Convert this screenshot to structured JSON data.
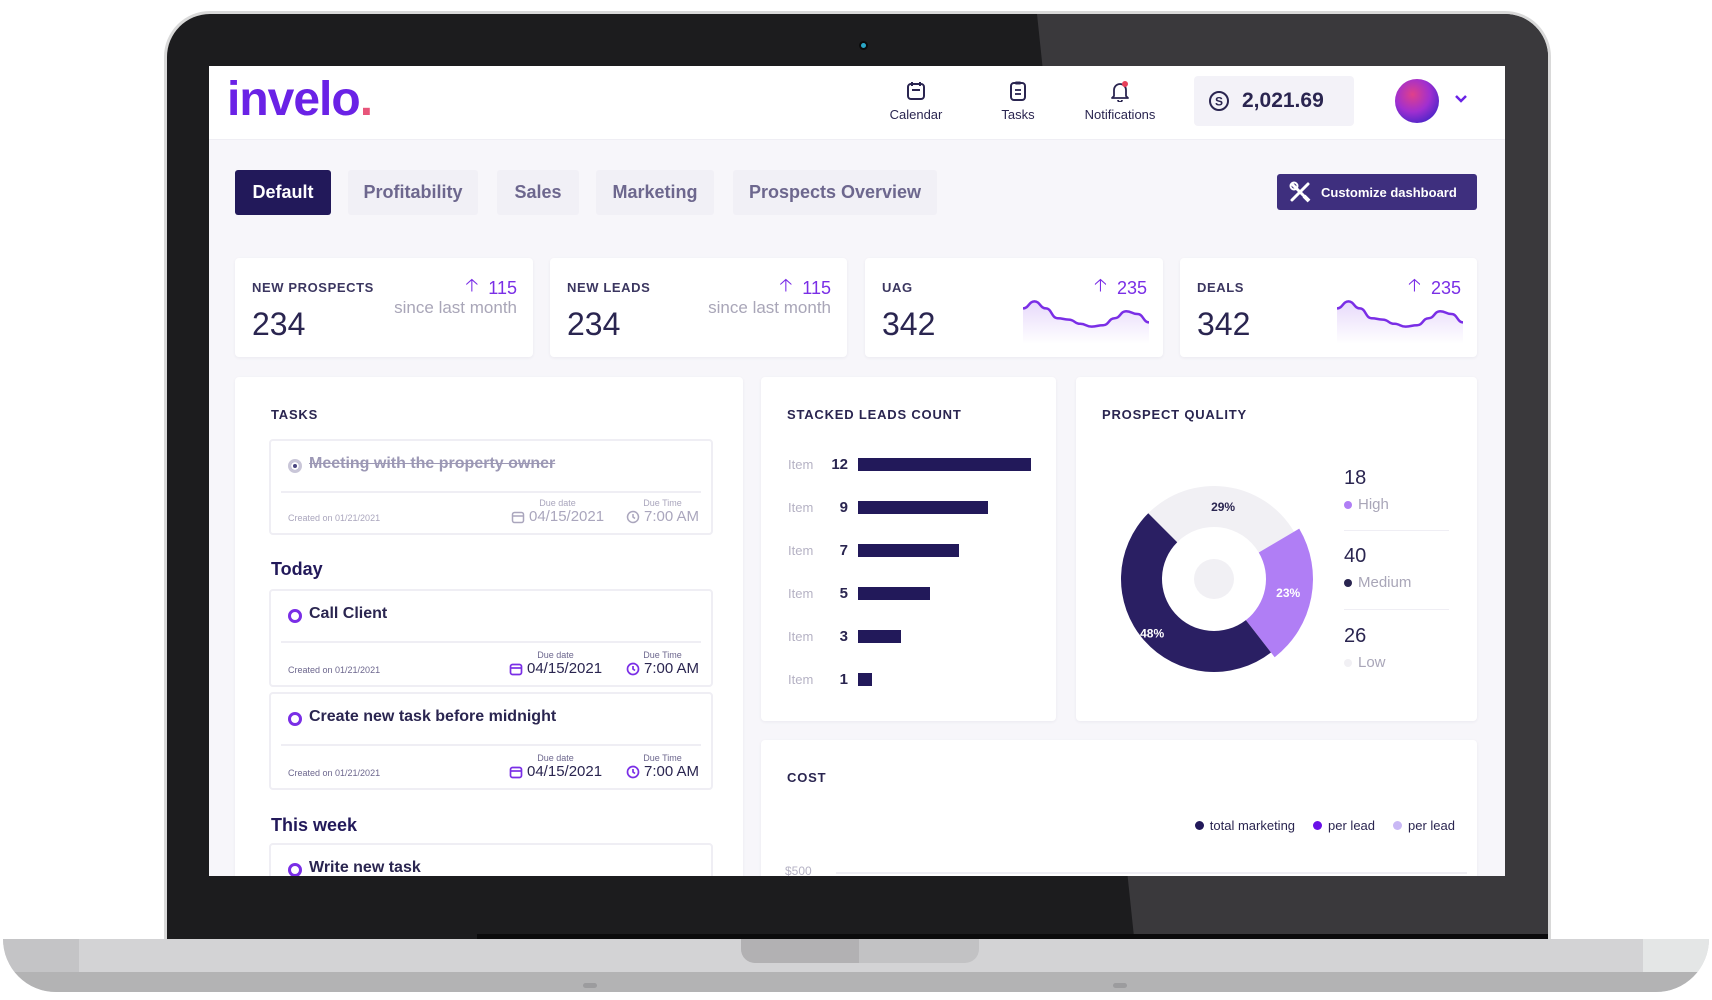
{
  "app": {
    "logo": "invelo",
    "logo_dot": ".",
    "accent_color": "#6a22e6",
    "dark_color": "#22195a"
  },
  "header": {
    "nav": [
      {
        "label": "Calendar",
        "icon": "calendar-icon"
      },
      {
        "label": "Tasks",
        "icon": "clipboard-icon"
      },
      {
        "label": "Notifications",
        "icon": "bell-icon"
      }
    ],
    "balance": "2,021.69",
    "balance_icon": "dollar-circle-icon"
  },
  "tabs": [
    {
      "label": "Default",
      "active": true
    },
    {
      "label": "Profitability",
      "active": false
    },
    {
      "label": "Sales",
      "active": false
    },
    {
      "label": "Marketing",
      "active": false
    },
    {
      "label": "Prospects Overview",
      "active": false
    }
  ],
  "customize_label": "Customize dashboard",
  "stats": [
    {
      "label": "NEW PROSPECTS",
      "value": "234",
      "delta": "115",
      "sub": "since last month"
    },
    {
      "label": "NEW LEADS",
      "value": "234",
      "delta": "115",
      "sub": "since last month"
    },
    {
      "label": "UAG",
      "value": "342",
      "delta": "235",
      "sparkline": [
        0.7,
        0.95,
        0.7,
        0.35,
        0.3,
        0.15,
        0.05,
        0.1,
        0.35,
        0.6,
        0.5,
        0.2
      ]
    },
    {
      "label": "DEALS",
      "value": "342",
      "delta": "235",
      "sparkline": [
        0.7,
        0.95,
        0.7,
        0.35,
        0.3,
        0.15,
        0.05,
        0.1,
        0.35,
        0.6,
        0.5,
        0.2
      ]
    }
  ],
  "tasks": {
    "title": "TASKS",
    "due_date_label": "Due date",
    "due_time_label": "Due Time",
    "completed": {
      "title": "Meeting with the property owner",
      "created": "Created on 01/21/2021",
      "due_date": "04/15/2021",
      "due_time": "7:00 AM"
    },
    "groups": [
      {
        "title": "Today",
        "items": [
          {
            "title": "Call Client",
            "created": "Created on 01/21/2021",
            "due_date": "04/15/2021",
            "due_time": "7:00 AM"
          },
          {
            "title": "Create new task before midnight",
            "created": "Created on 01/21/2021",
            "due_date": "04/15/2021",
            "due_time": "7:00 AM"
          }
        ]
      },
      {
        "title": "This week",
        "items": [
          {
            "title": "Write new task"
          }
        ]
      }
    ]
  },
  "chart_data": [
    {
      "type": "bar",
      "title": "STACKED LEADS COUNT",
      "orientation": "horizontal",
      "categories": [
        "Item",
        "Item",
        "Item",
        "Item",
        "Item",
        "Item"
      ],
      "values": [
        12,
        9,
        7,
        5,
        3,
        1
      ],
      "xlim": [
        0,
        12
      ]
    },
    {
      "type": "pie",
      "title": "PROSPECT QUALITY",
      "donut": true,
      "slices": [
        {
          "label": "Low",
          "percent": 29,
          "count": 26,
          "color": "#f1f0f4"
        },
        {
          "label": "High",
          "percent": 23,
          "count": 18,
          "color": "#b07ef5"
        },
        {
          "label": "Medium",
          "percent": 48,
          "count": 40,
          "color": "#2a1f63"
        }
      ],
      "legend": [
        {
          "value": "18",
          "label": "High",
          "color": "#b07ef5"
        },
        {
          "value": "40",
          "label": "Medium",
          "color": "#2a2550"
        },
        {
          "value": "26",
          "label": "Low",
          "color": "#f1f0f4"
        }
      ],
      "legend_position": "right"
    },
    {
      "type": "line",
      "title": "COST",
      "series": [
        {
          "name": "total marketing",
          "color": "#22195a",
          "values": []
        },
        {
          "name": "per lead",
          "color": "#6a10e8",
          "values": []
        },
        {
          "name": "per lead",
          "color": "#c9b8f5",
          "values": []
        }
      ],
      "ytick_labels": [
        "$500"
      ],
      "legend_position": "top-right"
    }
  ]
}
